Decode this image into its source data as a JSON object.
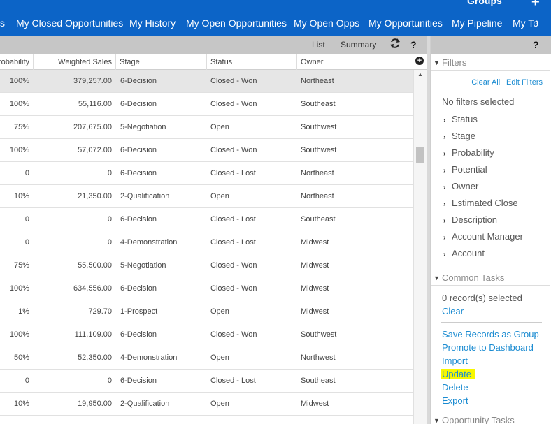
{
  "header": {
    "groups_label": "Groups",
    "add_icon": "+",
    "tabs": [
      {
        "label": "s"
      },
      {
        "label": "My Closed Opportunities"
      },
      {
        "label": "My History"
      },
      {
        "label": "My Open Opportunities"
      },
      {
        "label": "My Open Opps"
      },
      {
        "label": "My Opportunities"
      },
      {
        "label": "My Pipeline"
      },
      {
        "label": "My To"
      }
    ],
    "more_icon": "chevron-right-icon"
  },
  "toolbar": {
    "list_label": "List",
    "summary_label": "Summary",
    "help_label": "?"
  },
  "grid": {
    "columns": [
      {
        "label": "Probability"
      },
      {
        "label": "Weighted Sales"
      },
      {
        "label": "Stage"
      },
      {
        "label": "Status"
      },
      {
        "label": "Owner"
      }
    ],
    "rows": [
      {
        "probability": "100%",
        "weighted_sales": "379,257.00",
        "stage": "6-Decision",
        "status": "Closed - Won",
        "owner": "Northeast"
      },
      {
        "probability": "100%",
        "weighted_sales": "55,116.00",
        "stage": "6-Decision",
        "status": "Closed - Won",
        "owner": "Southeast"
      },
      {
        "probability": "75%",
        "weighted_sales": "207,675.00",
        "stage": "5-Negotiation",
        "status": "Open",
        "owner": "Southwest"
      },
      {
        "probability": "100%",
        "weighted_sales": "57,072.00",
        "stage": "6-Decision",
        "status": "Closed - Won",
        "owner": "Southwest"
      },
      {
        "probability": "0",
        "weighted_sales": "0",
        "stage": "6-Decision",
        "status": "Closed - Lost",
        "owner": "Northeast"
      },
      {
        "probability": "10%",
        "weighted_sales": "21,350.00",
        "stage": "2-Qualification",
        "status": "Open",
        "owner": "Northeast"
      },
      {
        "probability": "0",
        "weighted_sales": "0",
        "stage": "6-Decision",
        "status": "Closed - Lost",
        "owner": "Southeast"
      },
      {
        "probability": "0",
        "weighted_sales": "0",
        "stage": "4-Demonstration",
        "status": "Closed - Lost",
        "owner": "Midwest"
      },
      {
        "probability": "75%",
        "weighted_sales": "55,500.00",
        "stage": "5-Negotiation",
        "status": "Closed - Won",
        "owner": "Midwest"
      },
      {
        "probability": "100%",
        "weighted_sales": "634,556.00",
        "stage": "6-Decision",
        "status": "Closed - Won",
        "owner": "Midwest"
      },
      {
        "probability": "1%",
        "weighted_sales": "729.70",
        "stage": "1-Prospect",
        "status": "Open",
        "owner": "Midwest"
      },
      {
        "probability": "100%",
        "weighted_sales": "111,109.00",
        "stage": "6-Decision",
        "status": "Closed - Won",
        "owner": "Southwest"
      },
      {
        "probability": "50%",
        "weighted_sales": "52,350.00",
        "stage": "4-Demonstration",
        "status": "Open",
        "owner": "Northwest"
      },
      {
        "probability": "0",
        "weighted_sales": "0",
        "stage": "6-Decision",
        "status": "Closed - Lost",
        "owner": "Southeast"
      },
      {
        "probability": "10%",
        "weighted_sales": "19,950.00",
        "stage": "2-Qualification",
        "status": "Open",
        "owner": "Midwest"
      }
    ]
  },
  "panel": {
    "help_label": "?",
    "filters_title": "Filters",
    "clear_all": "Clear All",
    "separator": "|",
    "edit_filters": "Edit Filters",
    "no_filters": "No filters selected",
    "filter_items": [
      {
        "label": "Status"
      },
      {
        "label": "Stage"
      },
      {
        "label": "Probability"
      },
      {
        "label": "Potential"
      },
      {
        "label": "Owner"
      },
      {
        "label": "Estimated Close"
      },
      {
        "label": "Description"
      },
      {
        "label": "Account Manager"
      },
      {
        "label": "Account"
      }
    ],
    "common_tasks_title": "Common Tasks",
    "records_selected": "0 record(s) selected",
    "clear_label": "Clear",
    "tasks": [
      {
        "label": "Save Records as Group"
      },
      {
        "label": "Promote to Dashboard"
      },
      {
        "label": "Import"
      },
      {
        "label": "Update"
      },
      {
        "label": "Delete"
      },
      {
        "label": "Export"
      }
    ],
    "opportunity_tasks_title": "Opportunity Tasks"
  },
  "colors": {
    "nav_blue": "#0c64c7",
    "link_blue": "#1a8bd1",
    "highlight": "#f7f700"
  }
}
